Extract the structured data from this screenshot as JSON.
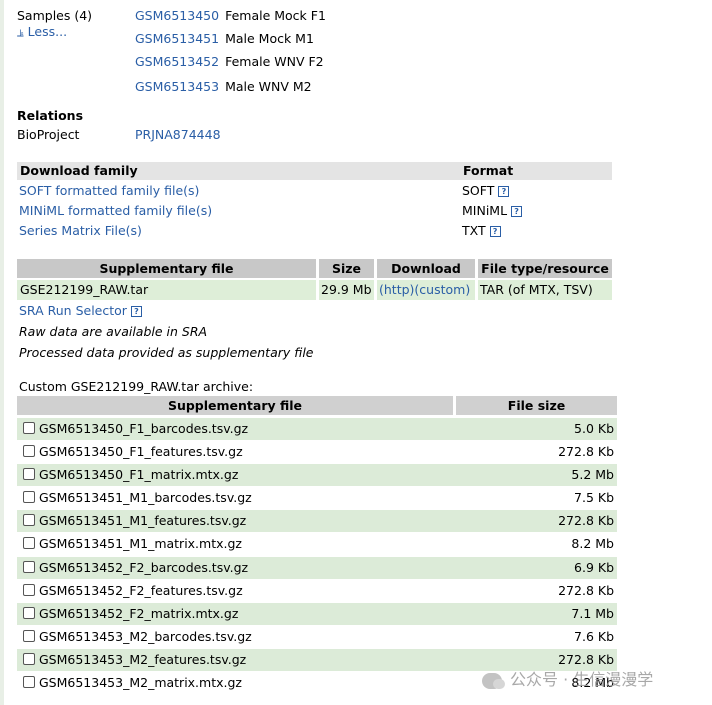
{
  "samples": {
    "label": "Samples (4)",
    "toggle": "Less...",
    "items": [
      {
        "acc": "GSM6513450",
        "desc": "Female Mock F1"
      },
      {
        "acc": "GSM6513451",
        "desc": "Male Mock M1"
      },
      {
        "acc": "GSM6513452",
        "desc": "Female WNV F2"
      },
      {
        "acc": "GSM6513453",
        "desc": "Male WNV M2"
      }
    ]
  },
  "relations": {
    "heading": "Relations",
    "bioproject_label": "BioProject",
    "bioproject_value": "PRJNA874448"
  },
  "download": {
    "header_family": "Download family",
    "header_format": "Format",
    "rows": [
      {
        "label": "SOFT formatted family file(s)",
        "format": "SOFT"
      },
      {
        "label": "MINiML formatted family file(s)",
        "format": "MINiML"
      },
      {
        "label": "Series Matrix File(s)",
        "format": "TXT"
      }
    ],
    "help_glyph": "?"
  },
  "supplementary": {
    "headers": [
      "Supplementary file",
      "Size",
      "Download",
      "File type/resource"
    ],
    "row": {
      "file": "GSE212199_RAW.tar",
      "size": "29.9 Mb",
      "http": "(http)",
      "custom": "(custom)",
      "type": "TAR (of MTX, TSV)"
    },
    "sra_link": "SRA Run Selector",
    "note1": "Raw data are available in SRA",
    "note2": "Processed data provided as supplementary file"
  },
  "archive": {
    "caption": "Custom GSE212199_RAW.tar archive:",
    "headers": [
      "Supplementary file",
      "File size"
    ],
    "files": [
      {
        "name": "GSM6513450_F1_barcodes.tsv.gz",
        "size": "5.0 Kb"
      },
      {
        "name": "GSM6513450_F1_features.tsv.gz",
        "size": "272.8 Kb"
      },
      {
        "name": "GSM6513450_F1_matrix.mtx.gz",
        "size": "5.2 Mb"
      },
      {
        "name": "GSM6513451_M1_barcodes.tsv.gz",
        "size": "7.5 Kb"
      },
      {
        "name": "GSM6513451_M1_features.tsv.gz",
        "size": "272.8 Kb"
      },
      {
        "name": "GSM6513451_M1_matrix.mtx.gz",
        "size": "8.2 Mb"
      },
      {
        "name": "GSM6513452_F2_barcodes.tsv.gz",
        "size": "6.9 Kb"
      },
      {
        "name": "GSM6513452_F2_features.tsv.gz",
        "size": "272.8 Kb"
      },
      {
        "name": "GSM6513452_F2_matrix.mtx.gz",
        "size": "7.1 Mb"
      },
      {
        "name": "GSM6513453_M2_barcodes.tsv.gz",
        "size": "7.6 Kb"
      },
      {
        "name": "GSM6513453_M2_features.tsv.gz",
        "size": "272.8 Kb"
      },
      {
        "name": "GSM6513453_M2_matrix.mtx.gz",
        "size": "8.2 Mb"
      }
    ]
  },
  "watermark": "公众号 · 生信漫漫学",
  "colors": {
    "link": "#2a5ea6",
    "header_gray": "#c8c8c8",
    "row_green": "#dcebd8"
  }
}
